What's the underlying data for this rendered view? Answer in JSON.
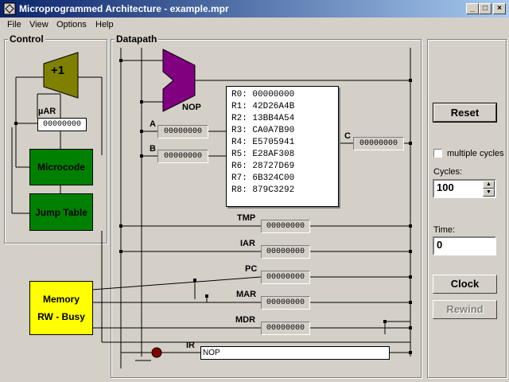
{
  "window": {
    "title": "Microprogrammed Architecture - example.mpr",
    "minimize": "_",
    "maximize": "□",
    "close": "×"
  },
  "menu": [
    "File",
    "View",
    "Options",
    "Help"
  ],
  "control": {
    "label": "Control",
    "adder_label": "+1",
    "uar_label": "µAR",
    "uar_value": "00000000",
    "microcode_label": "Microcode",
    "jump_table_label": "Jump Table"
  },
  "memory": {
    "label": "Memory",
    "status": "RW - Busy",
    "color": "#ffff00"
  },
  "datapath": {
    "label": "Datapath",
    "alu_op": "NOP",
    "alu_color": "#800080",
    "a_label": "A",
    "a_value": "00000000",
    "b_label": "B",
    "b_value": "00000000",
    "c_label": "C",
    "c_value": "00000000",
    "registers": [
      "R0: 00000000",
      "R1: 42D26A4B",
      "R2: 13BB4A54",
      "R3: CA0A7B90",
      "R4: E5705941",
      "R5: E28AF308",
      "R6: 28727D69",
      "R7: 6B324C00",
      "R8: 879C3292"
    ],
    "tmp_label": "TMP",
    "tmp_value": "00000000",
    "iar_label": "IAR",
    "iar_value": "00000000",
    "pc_label": "PC",
    "pc_value": "00000000",
    "mar_label": "MAR",
    "mar_value": "00000000",
    "mdr_label": "MDR",
    "mdr_value": "00000000",
    "ir_label": "IR",
    "ir_value": "NOP"
  },
  "side": {
    "reset": "Reset",
    "multiple_cycles": "multiple cycles",
    "multiple_cycles_checked": false,
    "cycles_label": "Cycles:",
    "cycles_value": "100",
    "time_label": "Time:",
    "time_value": "0",
    "clock": "Clock",
    "rewind": "Rewind"
  },
  "colors": {
    "microcode": "#008000",
    "adder": "#808000",
    "ir_led": "#800000"
  }
}
